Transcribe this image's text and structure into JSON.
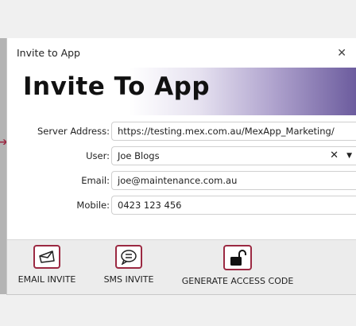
{
  "dialog": {
    "window_title": "Invite to App",
    "heading": "Invite To App"
  },
  "form": {
    "server_address": {
      "label": "Server Address:",
      "value": "https://testing.mex.com.au/MexApp_Marketing/"
    },
    "user": {
      "label": "User:",
      "value": "Joe Blogs"
    },
    "email": {
      "label": "Email:",
      "value": "joe@maintenance.com.au"
    },
    "mobile": {
      "label": "Mobile:",
      "value": "0423 123 456"
    }
  },
  "toolbar": {
    "email_invite": "EMAIL INVITE",
    "sms_invite": "SMS INVITE",
    "generate_access_code": "GENERATE ACCESS CODE"
  },
  "colors": {
    "accent": "#9b2942",
    "banner_gradient_end": "#6c5c9e"
  },
  "icons": [
    "close-icon",
    "clear-icon",
    "dropdown-arrow-icon",
    "envelope-icon",
    "chat-bubble-icon",
    "unlock-icon",
    "arrow-icon"
  ]
}
